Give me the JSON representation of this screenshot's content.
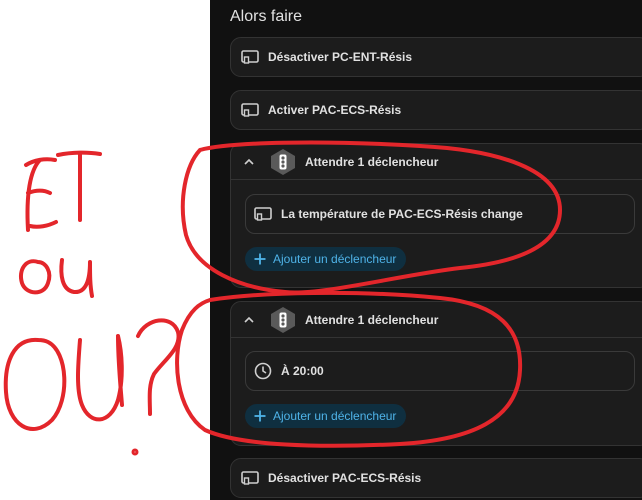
{
  "section_title": "Alors faire",
  "actions": {
    "disable_pc_ent": "Désactiver PC-ENT-Résis",
    "enable_pac_ecs": "Activer PAC-ECS-Résis",
    "disable_pac_ecs": "Désactiver PAC-ECS-Résis"
  },
  "wait_blocks": [
    {
      "title": "Attendre 1 déclencheur",
      "trigger": "La température de PAC-ECS-Résis change",
      "trigger_icon": "device-icon",
      "add_label": "Ajouter un déclencheur"
    },
    {
      "title": "Attendre 1 déclencheur",
      "trigger": "À 20:00",
      "trigger_icon": "clock-icon",
      "add_label": "Ajouter un déclencheur"
    }
  ],
  "annotations": {
    "word_1": "ET",
    "word_2": "ou",
    "word_3": "OU?"
  },
  "colors": {
    "panel_bg": "#111111",
    "card_bg": "#1c1c1c",
    "accent": "#4fb3e8",
    "annotation": "#e3262b"
  }
}
